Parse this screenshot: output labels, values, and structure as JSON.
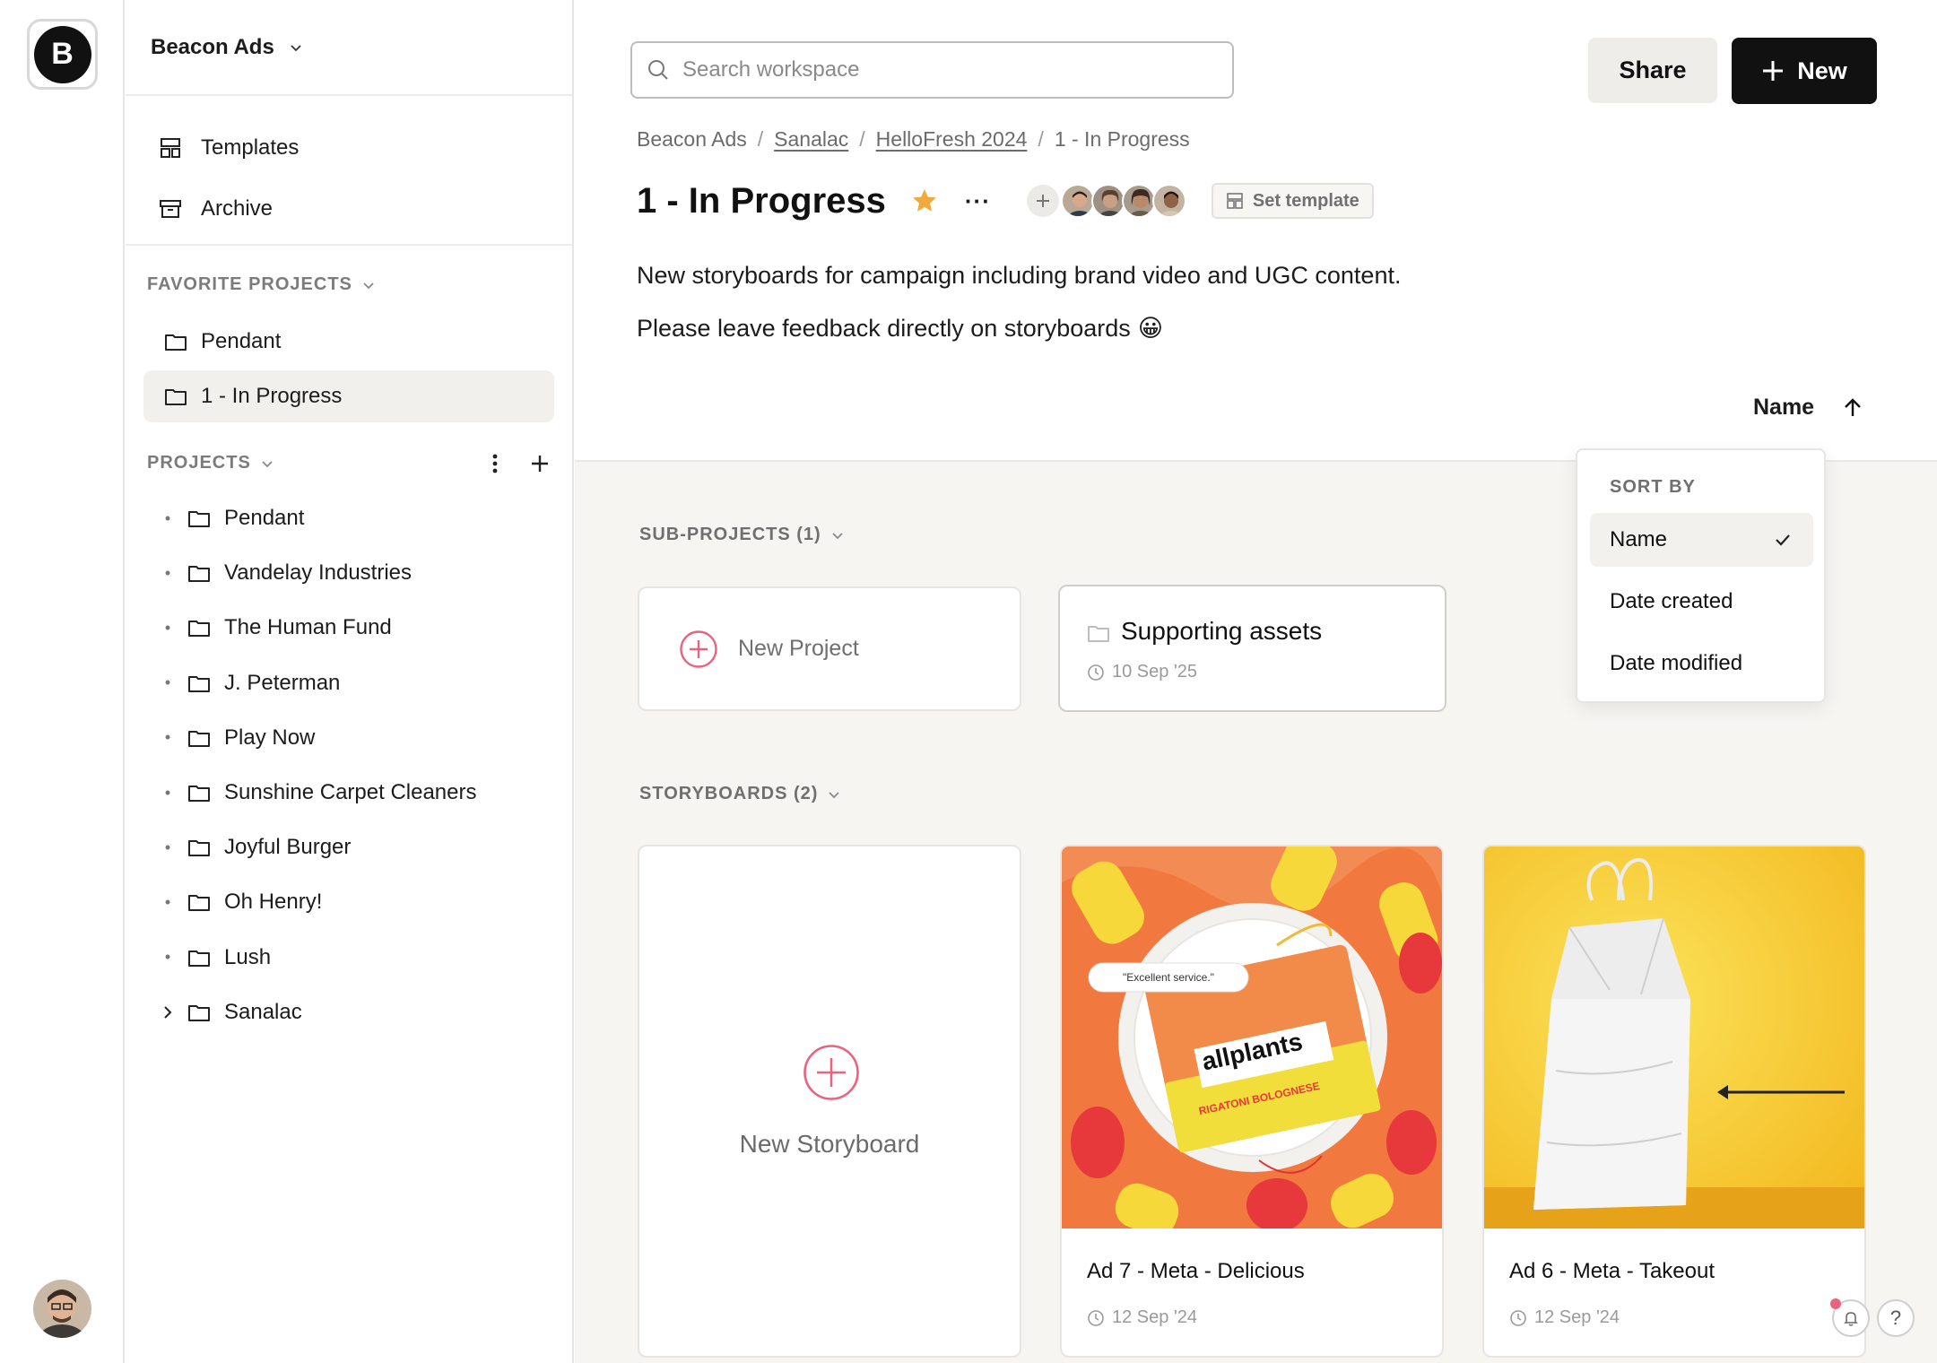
{
  "app": {
    "logo_letter": "B"
  },
  "workspace": {
    "name": "Beacon Ads"
  },
  "sidebar": {
    "links": [
      {
        "label": "Templates",
        "icon": "templates-icon"
      },
      {
        "label": "Archive",
        "icon": "archive-icon"
      }
    ],
    "favorites_label": "FAVORITE PROJECTS",
    "favorites": [
      {
        "label": "Pendant",
        "active": false
      },
      {
        "label": "1 - In Progress",
        "active": true
      }
    ],
    "projects_label": "PROJECTS",
    "projects": [
      {
        "label": "Pendant",
        "expandable": false
      },
      {
        "label": "Vandelay Industries",
        "expandable": false
      },
      {
        "label": "The Human Fund",
        "expandable": false
      },
      {
        "label": "J. Peterman",
        "expandable": false
      },
      {
        "label": "Play Now",
        "expandable": false
      },
      {
        "label": "Sunshine Carpet Cleaners",
        "expandable": false
      },
      {
        "label": "Joyful Burger",
        "expandable": false
      },
      {
        "label": "Oh Henry!",
        "expandable": false
      },
      {
        "label": "Lush",
        "expandable": false
      },
      {
        "label": "Sanalac",
        "expandable": true
      }
    ]
  },
  "header": {
    "search_placeholder": "Search workspace",
    "share_label": "Share",
    "new_label": "New"
  },
  "breadcrumb": {
    "items": [
      {
        "label": "Beacon Ads",
        "link": false
      },
      {
        "label": "Sanalac",
        "link": true
      },
      {
        "label": "HelloFresh 2024",
        "link": true
      },
      {
        "label": "1 - In Progress",
        "link": false
      }
    ],
    "separator": "/"
  },
  "project": {
    "title": "1 - In Progress",
    "starred": true,
    "more_label": "···",
    "set_template_label": "Set template",
    "description_line1": "New storyboards for campaign including brand video and UGC content.",
    "description_line2": "Please leave feedback directly on storyboards",
    "description_emoji": "😀"
  },
  "sort": {
    "current": "Name",
    "direction": "ascending",
    "menu_header": "SORT BY",
    "options": [
      {
        "label": "Name",
        "selected": true
      },
      {
        "label": "Date created",
        "selected": false
      },
      {
        "label": "Date modified",
        "selected": false
      }
    ]
  },
  "sub_projects": {
    "label": "SUB-PROJECTS (1)",
    "new_label": "New Project",
    "items": [
      {
        "name": "Supporting assets",
        "date": "10 Sep '25"
      }
    ]
  },
  "storyboards": {
    "label": "STORYBOARDS (2)",
    "new_label": "New Storyboard",
    "items": [
      {
        "name": "Ad 7 - Meta - Delicious",
        "date": "12 Sep '24",
        "thumb_quote": "\"Excellent service.\"",
        "thumb_brand": "allplants",
        "thumb_subtitle": "RIGATONI BOLOGNESE"
      },
      {
        "name": "Ad 6 - Meta - Takeout",
        "date": "12 Sep '24"
      }
    ]
  },
  "colors": {
    "accent_pink": "#e8637f",
    "star": "#f2a93b",
    "primary_button": "#111111",
    "canvas": "#f6f5f2"
  },
  "help_label": "?"
}
